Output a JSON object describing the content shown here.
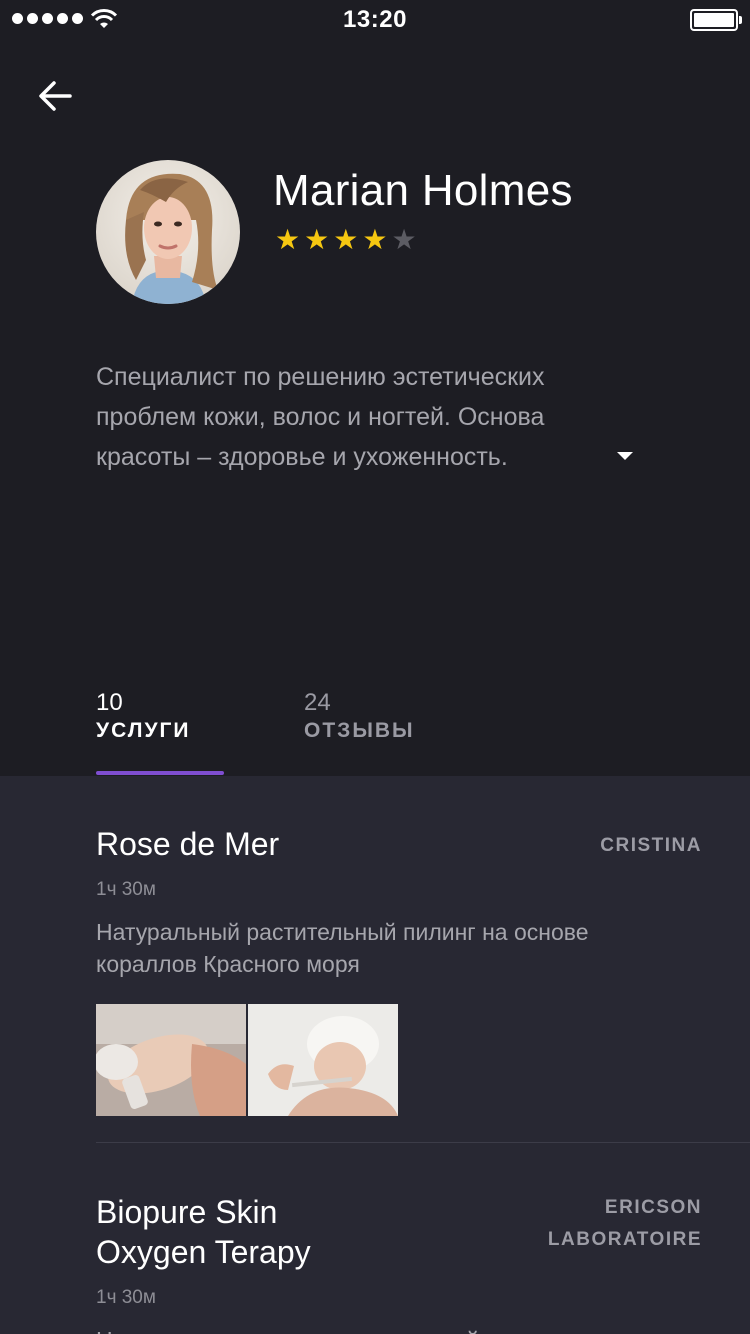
{
  "status_bar": {
    "time": "13:20"
  },
  "profile": {
    "name": "Marian Holmes",
    "rating": 4,
    "rating_max": 5,
    "bio": "Специалист по решению эстетических проблем кожи, волос и ногтей. Основа красоты – здоровье и ухоженность."
  },
  "tabs": [
    {
      "count": "10",
      "label": "УСЛУГИ",
      "active": true
    },
    {
      "count": "24",
      "label": "ОТЗЫВЫ",
      "active": false
    }
  ],
  "services": [
    {
      "title": "Rose de Mer",
      "vendor": "CRISTINA",
      "duration": "1ч 30м",
      "description": "Натуральный растительный пилинг на основе кораллов Красного моря"
    },
    {
      "title": "Biopure Skin Oxygen Terapy",
      "vendor": "ERICSON LABORATOIRE",
      "duration": "1ч 30м",
      "description": "Насыщение кожи кислородом и нейтрализация"
    }
  ],
  "colors": {
    "accent": "#7f4ed1",
    "star": "#f6c711",
    "background": "#1d1d23",
    "list_background": "#282833"
  }
}
